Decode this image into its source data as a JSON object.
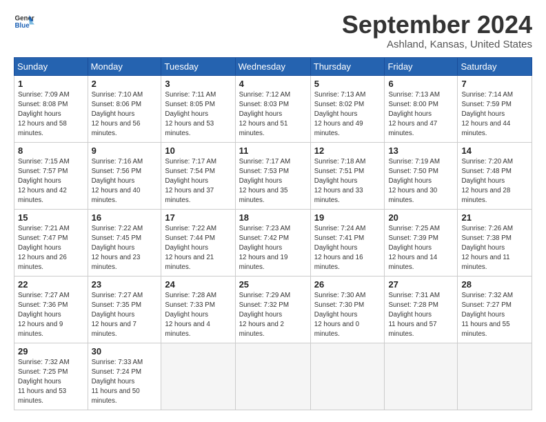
{
  "header": {
    "logo_line1": "General",
    "logo_line2": "Blue",
    "month_title": "September 2024",
    "location": "Ashland, Kansas, United States"
  },
  "weekdays": [
    "Sunday",
    "Monday",
    "Tuesday",
    "Wednesday",
    "Thursday",
    "Friday",
    "Saturday"
  ],
  "weeks": [
    [
      {
        "day": "1",
        "sunrise": "7:09 AM",
        "sunset": "8:08 PM",
        "daylight": "12 hours and 58 minutes."
      },
      {
        "day": "2",
        "sunrise": "7:10 AM",
        "sunset": "8:06 PM",
        "daylight": "12 hours and 56 minutes."
      },
      {
        "day": "3",
        "sunrise": "7:11 AM",
        "sunset": "8:05 PM",
        "daylight": "12 hours and 53 minutes."
      },
      {
        "day": "4",
        "sunrise": "7:12 AM",
        "sunset": "8:03 PM",
        "daylight": "12 hours and 51 minutes."
      },
      {
        "day": "5",
        "sunrise": "7:13 AM",
        "sunset": "8:02 PM",
        "daylight": "12 hours and 49 minutes."
      },
      {
        "day": "6",
        "sunrise": "7:13 AM",
        "sunset": "8:00 PM",
        "daylight": "12 hours and 47 minutes."
      },
      {
        "day": "7",
        "sunrise": "7:14 AM",
        "sunset": "7:59 PM",
        "daylight": "12 hours and 44 minutes."
      }
    ],
    [
      {
        "day": "8",
        "sunrise": "7:15 AM",
        "sunset": "7:57 PM",
        "daylight": "12 hours and 42 minutes."
      },
      {
        "day": "9",
        "sunrise": "7:16 AM",
        "sunset": "7:56 PM",
        "daylight": "12 hours and 40 minutes."
      },
      {
        "day": "10",
        "sunrise": "7:17 AM",
        "sunset": "7:54 PM",
        "daylight": "12 hours and 37 minutes."
      },
      {
        "day": "11",
        "sunrise": "7:17 AM",
        "sunset": "7:53 PM",
        "daylight": "12 hours and 35 minutes."
      },
      {
        "day": "12",
        "sunrise": "7:18 AM",
        "sunset": "7:51 PM",
        "daylight": "12 hours and 33 minutes."
      },
      {
        "day": "13",
        "sunrise": "7:19 AM",
        "sunset": "7:50 PM",
        "daylight": "12 hours and 30 minutes."
      },
      {
        "day": "14",
        "sunrise": "7:20 AM",
        "sunset": "7:48 PM",
        "daylight": "12 hours and 28 minutes."
      }
    ],
    [
      {
        "day": "15",
        "sunrise": "7:21 AM",
        "sunset": "7:47 PM",
        "daylight": "12 hours and 26 minutes."
      },
      {
        "day": "16",
        "sunrise": "7:22 AM",
        "sunset": "7:45 PM",
        "daylight": "12 hours and 23 minutes."
      },
      {
        "day": "17",
        "sunrise": "7:22 AM",
        "sunset": "7:44 PM",
        "daylight": "12 hours and 21 minutes."
      },
      {
        "day": "18",
        "sunrise": "7:23 AM",
        "sunset": "7:42 PM",
        "daylight": "12 hours and 19 minutes."
      },
      {
        "day": "19",
        "sunrise": "7:24 AM",
        "sunset": "7:41 PM",
        "daylight": "12 hours and 16 minutes."
      },
      {
        "day": "20",
        "sunrise": "7:25 AM",
        "sunset": "7:39 PM",
        "daylight": "12 hours and 14 minutes."
      },
      {
        "day": "21",
        "sunrise": "7:26 AM",
        "sunset": "7:38 PM",
        "daylight": "12 hours and 11 minutes."
      }
    ],
    [
      {
        "day": "22",
        "sunrise": "7:27 AM",
        "sunset": "7:36 PM",
        "daylight": "12 hours and 9 minutes."
      },
      {
        "day": "23",
        "sunrise": "7:27 AM",
        "sunset": "7:35 PM",
        "daylight": "12 hours and 7 minutes."
      },
      {
        "day": "24",
        "sunrise": "7:28 AM",
        "sunset": "7:33 PM",
        "daylight": "12 hours and 4 minutes."
      },
      {
        "day": "25",
        "sunrise": "7:29 AM",
        "sunset": "7:32 PM",
        "daylight": "12 hours and 2 minutes."
      },
      {
        "day": "26",
        "sunrise": "7:30 AM",
        "sunset": "7:30 PM",
        "daylight": "12 hours and 0 minutes."
      },
      {
        "day": "27",
        "sunrise": "7:31 AM",
        "sunset": "7:28 PM",
        "daylight": "11 hours and 57 minutes."
      },
      {
        "day": "28",
        "sunrise": "7:32 AM",
        "sunset": "7:27 PM",
        "daylight": "11 hours and 55 minutes."
      }
    ],
    [
      {
        "day": "29",
        "sunrise": "7:32 AM",
        "sunset": "7:25 PM",
        "daylight": "11 hours and 53 minutes."
      },
      {
        "day": "30",
        "sunrise": "7:33 AM",
        "sunset": "7:24 PM",
        "daylight": "11 hours and 50 minutes."
      },
      null,
      null,
      null,
      null,
      null
    ]
  ]
}
